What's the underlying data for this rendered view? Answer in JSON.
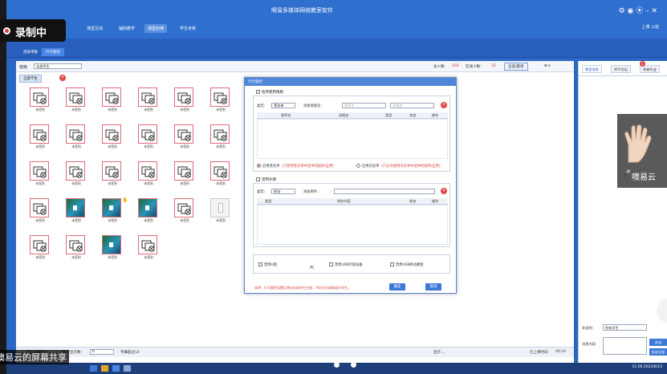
{
  "window": {
    "title": "噢易多媒体网络教室软件",
    "controls": "⚙ ◉ ⦿ – ✕"
  },
  "recording": {
    "label": "录制中"
  },
  "share": {
    "label": "噢易云的屏幕共享"
  },
  "nav": {
    "tabs": [
      "课堂互动",
      "辅助教学",
      "课堂纪律",
      "学生考核"
    ],
    "active": 2,
    "user": "上课  三班"
  },
  "subnav": {
    "tabs": [
      "黑屏肃静",
      "行为管控"
    ],
    "active": 1
  },
  "filter": {
    "group_label": "班级",
    "group_value": "全部学生",
    "total_label": "总人数：",
    "total_value": "160",
    "online_label": "在线人数：",
    "online_value": "33",
    "select_all": "全选/取消",
    "view_icon": "⊞ ▾",
    "group_tab": "全部学生"
  },
  "students": [
    {
      "label": "未签到",
      "kind": "off"
    },
    {
      "label": "未签到",
      "kind": "off"
    },
    {
      "label": "未签到",
      "kind": "off"
    },
    {
      "label": "未签到",
      "kind": "off"
    },
    {
      "label": "未签到",
      "kind": "off"
    },
    {
      "label": "未签到",
      "kind": "off"
    },
    {
      "label": "未签到",
      "kind": "off"
    },
    {
      "label": "未签到",
      "kind": "off"
    },
    {
      "label": "未签到",
      "kind": "off"
    },
    {
      "label": "未签到",
      "kind": "off"
    },
    {
      "label": "未签到",
      "kind": "off"
    },
    {
      "label": "未签到",
      "kind": "off"
    },
    {
      "label": "未签到",
      "kind": "off"
    },
    {
      "label": "未签到",
      "kind": "off"
    },
    {
      "label": "未签到",
      "kind": "off"
    },
    {
      "label": "未签到",
      "kind": "off"
    },
    {
      "label": "未签到",
      "kind": "off"
    },
    {
      "label": "未签到",
      "kind": "off"
    },
    {
      "label": "未签到",
      "kind": "off"
    },
    {
      "label": "未签到",
      "kind": "screen"
    },
    {
      "label": "未签到",
      "kind": "screen",
      "raise": true
    },
    {
      "label": "未签到",
      "kind": "screen"
    },
    {
      "label": "未签到",
      "kind": "off"
    },
    {
      "label": "未签到",
      "kind": "doc"
    },
    {
      "label": "未签到",
      "kind": "off"
    },
    {
      "label": "未签到",
      "kind": "off"
    },
    {
      "label": "未签到",
      "kind": "screen"
    },
    {
      "label": "未签到",
      "kind": "off"
    }
  ],
  "dialog": {
    "title": "行为管控",
    "program": {
      "check_label": "程序使用限制",
      "type_label": "类型：",
      "type_value": "黑名单",
      "add_label": "添加进程名：",
      "input1_placeholder": "程序名",
      "input2_placeholder": "进程名",
      "columns": [
        "程序名",
        "进程名",
        "类型",
        "状态",
        "操作"
      ],
      "radio_black": "启用黑名单",
      "radio_black_note": "（只禁用黑名单中选中的程序/应用）",
      "radio_white": "启用白名单",
      "radio_white_note": "（只允许使用白名单中选中的程序/应用）"
    },
    "web": {
      "check_label": "禁用外网",
      "type_label": "类型：",
      "type_value": "网址",
      "add_label": "添加例外：",
      "columns": [
        "类型",
        "例外内容",
        "状态",
        "操作"
      ]
    },
    "options": [
      "禁用U盘",
      "禁用USB外接设备",
      "禁用USB移动硬盘"
    ],
    "note": "说明：行为管控设置后将对全体学生生效，不区分分组和部分学生。",
    "ok": "确定",
    "cancel": "取消"
  },
  "right": {
    "tabs": [
      "教室消息",
      "举手讨论",
      "答卷作业"
    ],
    "unread": "1",
    "cam_label": "噢易云",
    "sendto_label": "发送到：",
    "sendto_value": "所有学生",
    "msg_label": "消息内容：",
    "send": "发送",
    "send_all": "发送全部"
  },
  "status": {
    "share": "屏幕演示",
    "screen_count_label": "每行显示数：",
    "screen_count_value": "6",
    "subtitle": "字幕超过14",
    "display": "显示  ⌄",
    "time_label": "已上课时间",
    "time_value": "00:24"
  },
  "taskbar": {
    "time": "11:06",
    "date": "2023/6/14"
  },
  "colors": {
    "accent": "#2f6fce",
    "alert": "#e04848",
    "offline_frame": "#e06a7a"
  }
}
